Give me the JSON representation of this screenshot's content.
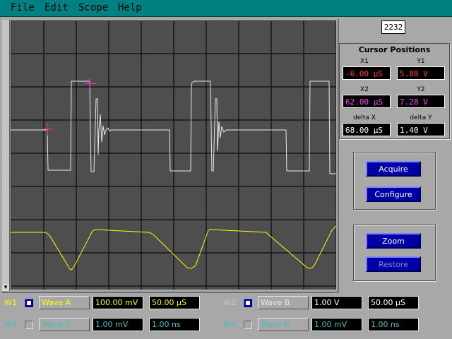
{
  "menu": {
    "items": [
      {
        "label": "File"
      },
      {
        "label": "Edit"
      },
      {
        "label": "Scope"
      },
      {
        "label": "Help"
      }
    ]
  },
  "counter": {
    "value": "2232"
  },
  "cursor_positions": {
    "title": "Cursor Positions",
    "x1": {
      "label": "X1",
      "value": "-6.00 µS"
    },
    "y1": {
      "label": "Y1",
      "value": "5.88 V"
    },
    "x2": {
      "label": "X2",
      "value": "62.00 µS"
    },
    "y2": {
      "label": "Y2",
      "value": "7.28 V"
    },
    "dx": {
      "label": "delta X",
      "value": "68.00 µS"
    },
    "dy": {
      "label": "delta Y",
      "value": "1.40 V"
    }
  },
  "buttons": {
    "acquire": "Acquire",
    "configure": "Configure",
    "zoom": "Zoom",
    "restore": "Restore"
  },
  "waveforms": [
    {
      "label": "W1:",
      "name": "Wave A",
      "volts": "100.00 mV",
      "time": "50.00 µS",
      "enabled": true
    },
    {
      "label": "W2:",
      "name": "Wave B",
      "volts": "1.00 V",
      "time": "50.00 µS",
      "enabled": true
    },
    {
      "label": "W3:",
      "name": "Wave C",
      "volts": "1.00 mV",
      "time": "1.00 ns",
      "enabled": false
    },
    {
      "label": "W4:",
      "name": "Wave D",
      "volts": "1.00 mV",
      "time": "1.00 ns",
      "enabled": false
    }
  ],
  "colors": {
    "wave_a": "#ffff00",
    "wave_b": "#e8e8e8",
    "cursor1": "#ff4040",
    "cursor2": "#ff40ff",
    "label_active": "#ffff00",
    "label_inactive": "#40c0c0",
    "text_dim": "#c8c8c8"
  }
}
